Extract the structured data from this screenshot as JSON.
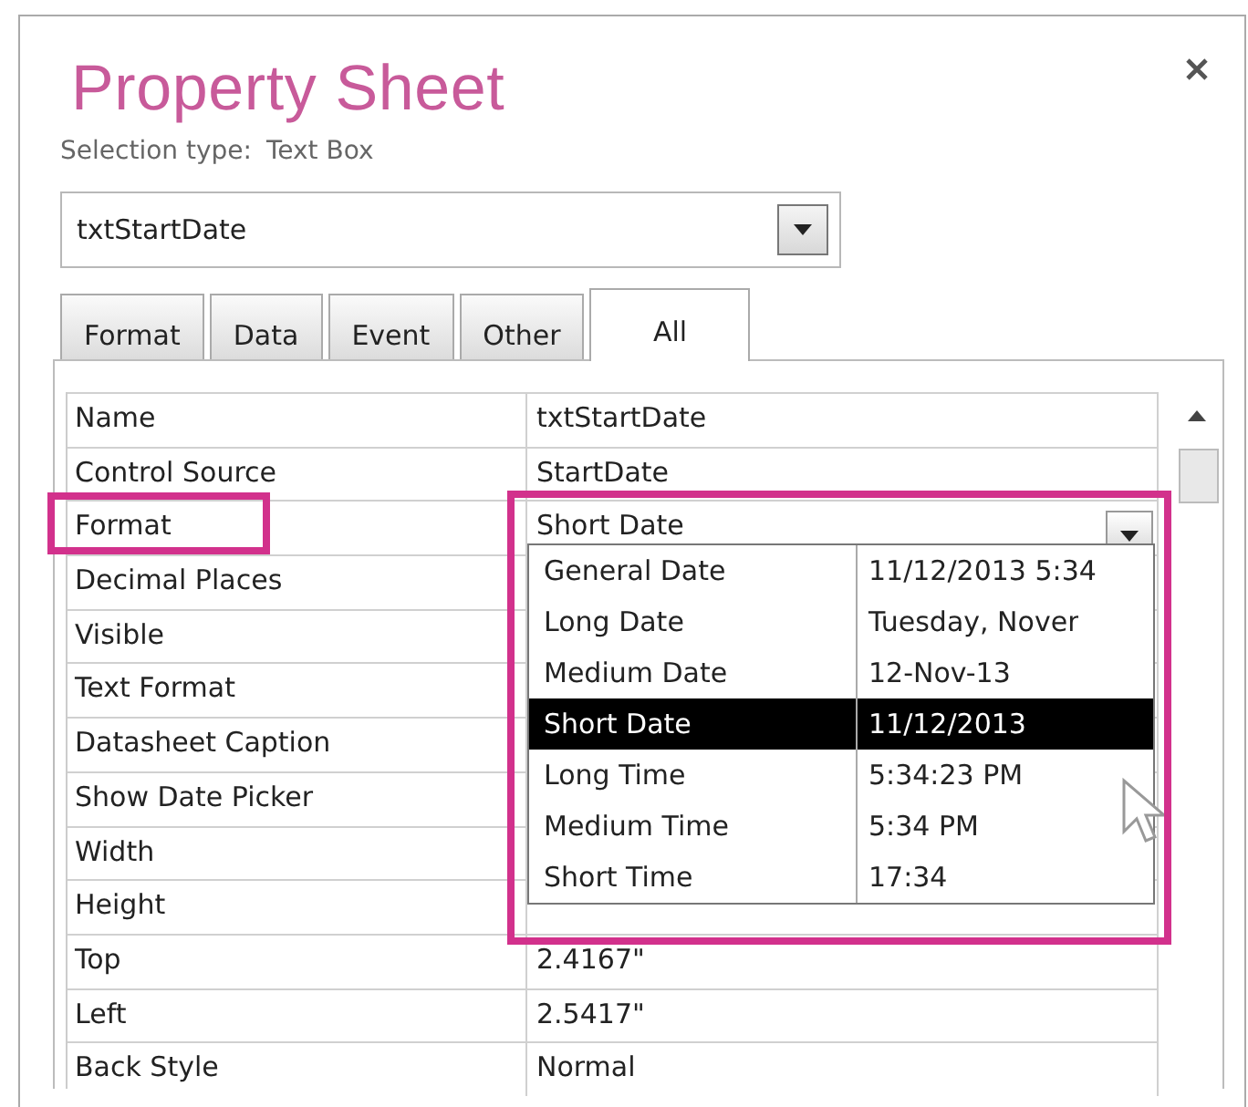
{
  "panel": {
    "title": "Property Sheet",
    "selection_label": "Selection type:",
    "selection_type": "Text Box"
  },
  "object_combo": {
    "value": "txtStartDate"
  },
  "tabs": [
    {
      "label": "Format",
      "selected": false
    },
    {
      "label": "Data",
      "selected": false
    },
    {
      "label": "Event",
      "selected": false
    },
    {
      "label": "Other",
      "selected": false
    },
    {
      "label": "All",
      "selected": true
    }
  ],
  "properties": [
    {
      "name": "Name",
      "value": "txtStartDate",
      "kind": "text",
      "highlighted": false
    },
    {
      "name": "Control Source",
      "value": "StartDate",
      "kind": "text",
      "highlighted": false
    },
    {
      "name": "Format",
      "value": "Short Date",
      "kind": "dropdown",
      "highlighted": true
    },
    {
      "name": "Decimal Places",
      "kind": "text",
      "highlighted": false
    },
    {
      "name": "Visible",
      "kind": "text",
      "highlighted": false
    },
    {
      "name": "Text Format",
      "kind": "text",
      "highlighted": false
    },
    {
      "name": "Datasheet Caption",
      "kind": "text",
      "highlighted": false
    },
    {
      "name": "Show Date Picker",
      "kind": "text",
      "highlighted": false
    },
    {
      "name": "Width",
      "kind": "text",
      "highlighted": false
    },
    {
      "name": "Height",
      "kind": "text",
      "highlighted": false
    },
    {
      "name": "Top",
      "value": "2.4167\"",
      "kind": "text",
      "highlighted": false
    },
    {
      "name": "Left",
      "value": "2.5417\"",
      "kind": "text",
      "highlighted": false
    },
    {
      "name": "Back Style",
      "value": "Normal",
      "kind": "text",
      "highlighted": false
    }
  ],
  "format_list": {
    "highlighted": true,
    "options": [
      {
        "name": "General Date",
        "example": "11/12/2013 5:34",
        "selected": false
      },
      {
        "name": "Long Date",
        "example": "Tuesday, Nover",
        "selected": false
      },
      {
        "name": "Medium Date",
        "example": "12-Nov-13",
        "selected": false
      },
      {
        "name": "Short Date",
        "example": "11/12/2013",
        "selected": true
      },
      {
        "name": "Long Time",
        "example": "5:34:23 PM",
        "selected": false
      },
      {
        "name": "Medium Time",
        "example": "5:34 PM",
        "selected": false
      },
      {
        "name": "Short Time",
        "example": "17:34",
        "selected": false
      }
    ]
  }
}
